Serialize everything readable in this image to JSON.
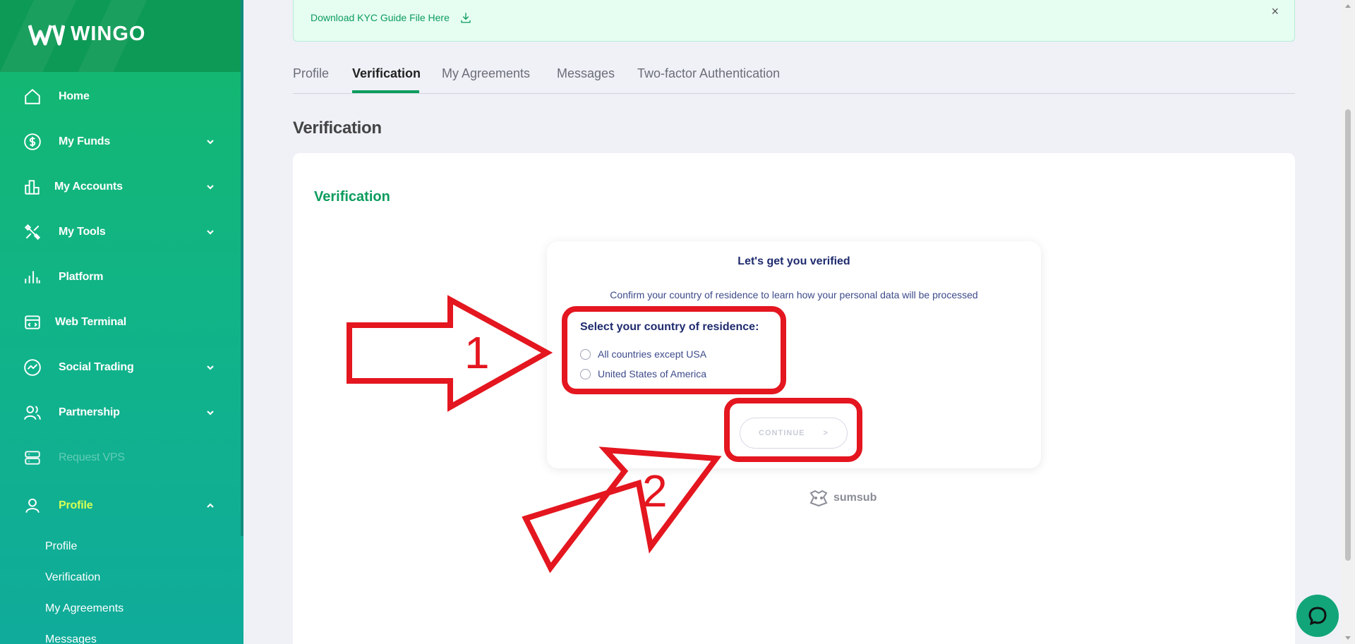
{
  "brand": {
    "name": "WINGO"
  },
  "sidebar": {
    "items": [
      {
        "label": "Home",
        "icon": "home-icon",
        "expandable": false
      },
      {
        "label": "My Funds",
        "icon": "dollar-icon",
        "expandable": true
      },
      {
        "label": "My Accounts",
        "icon": "chart-bars-icon",
        "expandable": true
      },
      {
        "label": "My Tools",
        "icon": "tools-icon",
        "expandable": true
      },
      {
        "label": "Platform",
        "icon": "platform-icon",
        "expandable": false
      },
      {
        "label": "Web Terminal",
        "icon": "terminal-icon",
        "expandable": false
      },
      {
        "label": "Social Trading",
        "icon": "trend-icon",
        "expandable": true
      },
      {
        "label": "Partnership",
        "icon": "users-icon",
        "expandable": true
      },
      {
        "label": "Request VPS",
        "icon": "server-icon",
        "expandable": false,
        "disabled": true
      },
      {
        "label": "Profile",
        "icon": "user-icon",
        "expandable": true,
        "expanded": true,
        "active": true
      }
    ],
    "profile_sub": [
      "Profile",
      "Verification",
      "My Agreements",
      "Messages"
    ]
  },
  "kyc_banner": {
    "link": "Download KYC Guide File Here",
    "close": "×"
  },
  "tabs": [
    "Profile",
    "Verification",
    "My Agreements",
    "Messages",
    "Two-factor Authentication"
  ],
  "active_tab": "Verification",
  "page_title": "Verification",
  "card": {
    "title": "Verification",
    "box": {
      "title": "Let's get you verified",
      "description": "Confirm your country of residence to learn how your personal data will be processed",
      "select_label": "Select your country of residence:",
      "options": [
        "All countries except USA",
        "United States of America"
      ],
      "continue_label": "CONTINUE",
      "continue_arrow": ">"
    },
    "powered_by": "sumsub"
  },
  "annotations": {
    "step1": "1",
    "step2": "2",
    "color": "#e4161f"
  },
  "colors": {
    "accent": "#0c9c5d",
    "sidebar": "#10b38a",
    "navy": "#1f2b6e"
  }
}
